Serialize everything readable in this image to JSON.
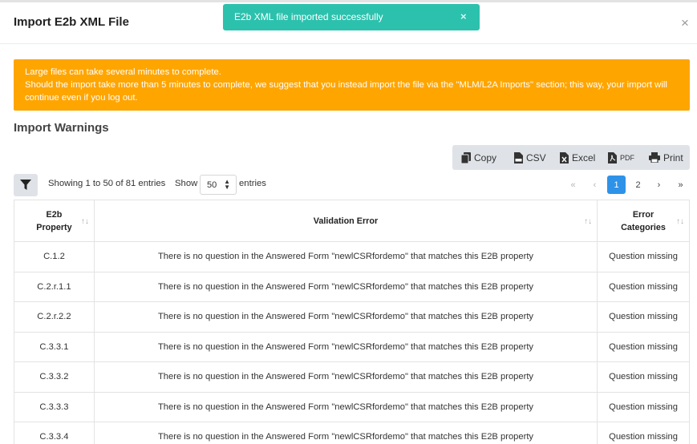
{
  "modal": {
    "title": "Import E2b XML File",
    "close_glyph": "×"
  },
  "toast": {
    "message": "E2b XML file imported successfully",
    "close_glyph": "×"
  },
  "alert": {
    "line1": "Large files can take several minutes to complete.",
    "line2": "Should the import take more than 5 minutes to complete, we suggest that you instead import the file via the \"MLM/L2A Imports\" section; this way, your import will continue even if you log out."
  },
  "section_title": "Import Warnings",
  "export_buttons": {
    "copy": "Copy",
    "csv": "CSV",
    "excel": "Excel",
    "pdf": "PDF",
    "print": "Print"
  },
  "table_info": "Showing 1 to 50 of 81 entries",
  "length": {
    "show_label": "Show",
    "value": "50",
    "entries_label": "entries"
  },
  "pagination": {
    "first": "«",
    "prev": "‹",
    "page1": "1",
    "page2": "2",
    "next": "›",
    "last": "»"
  },
  "columns": {
    "property_l1": "E2b",
    "property_l2": "Property",
    "error": "Validation Error",
    "category_l1": "Error",
    "category_l2": "Categories",
    "sort_glyph": "↑↓"
  },
  "rows": [
    {
      "property": "C.1.2",
      "error": "There is no question in the Answered Form \"newlCSRfordemo\" that matches this E2B property",
      "category": "Question missing"
    },
    {
      "property": "C.2.r.1.1",
      "error": "There is no question in the Answered Form \"newlCSRfordemo\" that matches this E2B property",
      "category": "Question missing"
    },
    {
      "property": "C.2.r.2.2",
      "error": "There is no question in the Answered Form \"newlCSRfordemo\" that matches this E2B property",
      "category": "Question missing"
    },
    {
      "property": "C.3.3.1",
      "error": "There is no question in the Answered Form \"newlCSRfordemo\" that matches this E2B property",
      "category": "Question missing"
    },
    {
      "property": "C.3.3.2",
      "error": "There is no question in the Answered Form \"newlCSRfordemo\" that matches this E2B property",
      "category": "Question missing"
    },
    {
      "property": "C.3.3.3",
      "error": "There is no question in the Answered Form \"newlCSRfordemo\" that matches this E2B property",
      "category": "Question missing"
    },
    {
      "property": "C.3.3.4",
      "error": "There is no question in the Answered Form \"newlCSRfordemo\" that matches this E2B property",
      "category": "Question missing"
    }
  ],
  "colors": {
    "toast": "#2cc1ad",
    "alert": "#ffa500",
    "active_page": "#2e92e8",
    "button_bg": "#dfe3e8"
  }
}
